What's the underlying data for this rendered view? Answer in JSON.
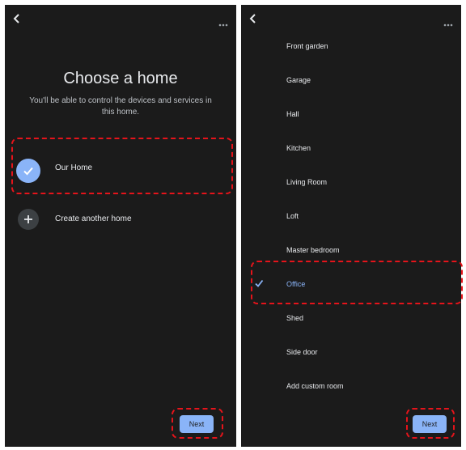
{
  "left_screen": {
    "title": "Choose a home",
    "subtitle": "You'll be able to control the devices and services in this home.",
    "home_option": "Our Home",
    "create_option": "Create another home",
    "next_label": "Next"
  },
  "right_screen": {
    "rooms": [
      {
        "label": "Front garden",
        "selected": false
      },
      {
        "label": "Garage",
        "selected": false
      },
      {
        "label": "Hall",
        "selected": false
      },
      {
        "label": "Kitchen",
        "selected": false
      },
      {
        "label": "Living Room",
        "selected": false
      },
      {
        "label": "Loft",
        "selected": false
      },
      {
        "label": "Master bedroom",
        "selected": false
      },
      {
        "label": "Office",
        "selected": true
      },
      {
        "label": "Shed",
        "selected": false
      },
      {
        "label": "Side door",
        "selected": false
      },
      {
        "label": "Add custom room",
        "selected": false
      }
    ],
    "next_label": "Next"
  },
  "colors": {
    "background": "#1b1b1b",
    "accent": "#8ab4f8",
    "highlight": "#e5141b"
  },
  "icons": [
    "back-arrow-icon",
    "more-options-icon",
    "checkmark-icon",
    "plus-icon"
  ]
}
